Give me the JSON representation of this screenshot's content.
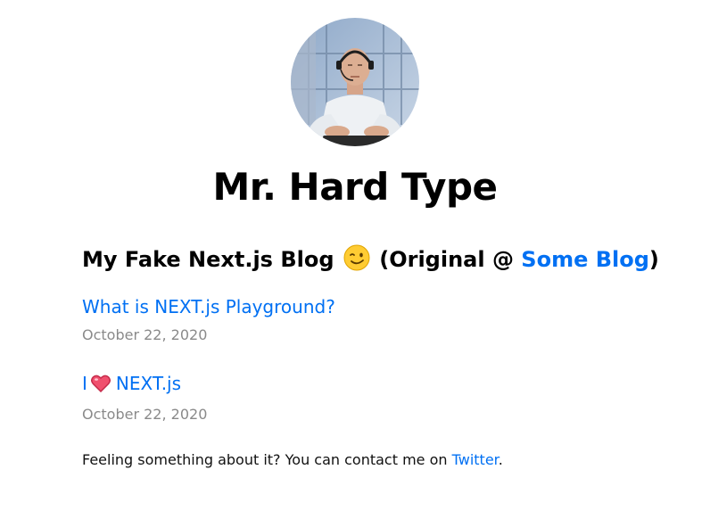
{
  "profile": {
    "name": "Mr. Hard Type",
    "avatar_icon": "profile-photo"
  },
  "blog": {
    "heading_prefix": "My Fake Next.js Blog",
    "heading_emoji": "winking-face-emoji",
    "heading_original": "(Original @",
    "heading_link": "Some Blog",
    "heading_suffix": ")"
  },
  "posts": [
    {
      "title": "What is NEXT.js Playground?",
      "date": "October 22, 2020"
    },
    {
      "title_prefix": "I",
      "title_icon": "heart-emoji",
      "title_suffix": "NEXT.js",
      "date": "October 22, 2020"
    }
  ],
  "footer": {
    "text": "Feeling something about it? You can contact me on",
    "link": "Twitter",
    "end": "."
  },
  "colors": {
    "link": "#0070f3",
    "date": "#8a8a8a",
    "text": "#111111"
  }
}
